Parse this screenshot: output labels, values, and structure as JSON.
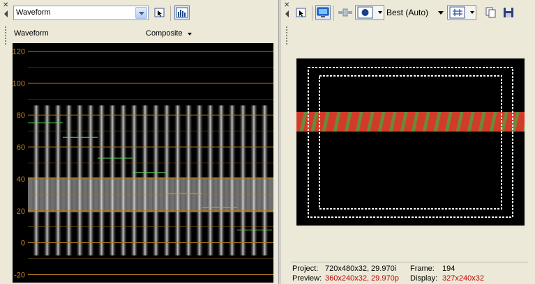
{
  "left_panel": {
    "scope_dropdown": {
      "value": "Waveform"
    },
    "scope_label": "Waveform",
    "mode_dropdown": {
      "value": "Composite"
    },
    "waveform": {
      "ticks": [
        "120",
        "100",
        "80",
        "60",
        "40",
        "20",
        "0",
        "-20"
      ],
      "tick_values": [
        120,
        100,
        80,
        60,
        40,
        20,
        0,
        -20
      ],
      "y_range": [
        -25,
        125
      ],
      "colors": {
        "grid": "#b07a1f",
        "label": "#c8841e",
        "trace": "#d8d8d8",
        "luma_marker": "#58d858",
        "band": "#707070"
      },
      "bar_levels": [
        75,
        66,
        53,
        44,
        31,
        22,
        8
      ]
    }
  },
  "right_panel": {
    "quality": "Best (Auto)",
    "preview": {
      "stripe_colors": [
        "#d23a2a",
        "#6a8a3a"
      ],
      "safe_area_color": "#ffffff"
    },
    "status": {
      "project_label": "Project:",
      "project_value": "720x480x32, 29.970i",
      "preview_label": "Preview:",
      "preview_value": "360x240x32, 29.970p",
      "frame_label": "Frame:",
      "frame_value": "194",
      "display_label": "Display:",
      "display_value": "327x240x32"
    }
  }
}
